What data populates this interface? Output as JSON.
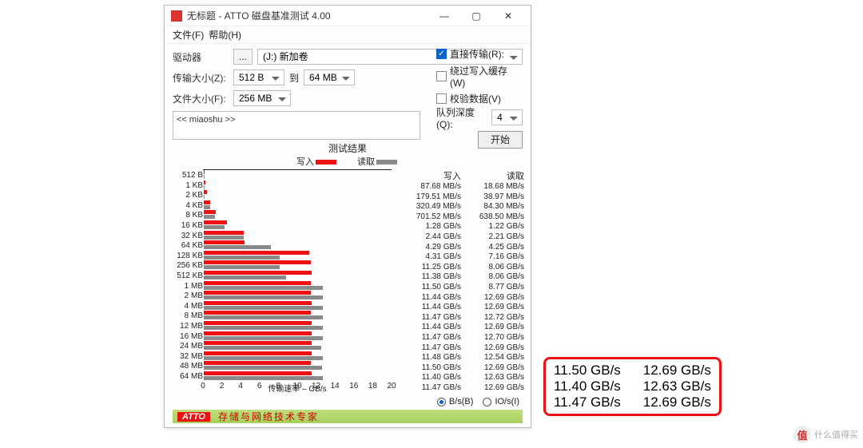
{
  "window": {
    "title": "无标题 - ATTO 磁盘基准测试 4.00",
    "menu": {
      "file": "文件(F)",
      "help": "帮助(H)"
    }
  },
  "form": {
    "drive_label": "驱动器",
    "browse": "...",
    "drive_value": "(J:) 新加卷",
    "xfersize_label": "传输大小(Z):",
    "xfersize_from": "512 B",
    "xfersize_to_label": "到",
    "xfersize_to": "64 MB",
    "filesize_label": "文件大小(F):",
    "filesize_value": "256 MB",
    "direct": "直接传输(R):",
    "direct_checked": true,
    "bypass": "绕过写入缓存(W)",
    "verify": "校验数据(V)",
    "qd_label": "队列深度(Q):",
    "qd_value": "4",
    "start": "开始",
    "desc": "<< miaoshu >>"
  },
  "results": {
    "title": "测试结果",
    "legend_write": "写入",
    "legend_read": "读取",
    "write_hdr": "写入",
    "read_hdr": "读取",
    "xaxis_label": "传输速率 – GB/s",
    "unit_bs": "B/s(B)",
    "unit_ios": "IO/s(I)"
  },
  "footer": {
    "logo": "ATTO",
    "slogan": "存储与网络技术专家"
  },
  "callout": {
    "rows": [
      {
        "w": "11.50 GB/s",
        "r": "12.69 GB/s"
      },
      {
        "w": "11.40 GB/s",
        "r": "12.63 GB/s"
      },
      {
        "w": "11.47 GB/s",
        "r": "12.69 GB/s"
      }
    ]
  },
  "watermark": "什么值得买",
  "chart_data": {
    "type": "bar",
    "orientation": "horizontal",
    "title": "测试结果",
    "xlabel": "传输速率 – GB/s",
    "xlim": [
      0,
      20
    ],
    "xticks": [
      0,
      2,
      4,
      6,
      8,
      10,
      12,
      14,
      16,
      18,
      20
    ],
    "categories": [
      "512 B",
      "1 KB",
      "2 KB",
      "4 KB",
      "8 KB",
      "16 KB",
      "32 KB",
      "64 KB",
      "128 KB",
      "256 KB",
      "512 KB",
      "1 MB",
      "2 MB",
      "4 MB",
      "8 MB",
      "12 MB",
      "16 MB",
      "24 MB",
      "32 MB",
      "48 MB",
      "64 MB"
    ],
    "series": [
      {
        "name": "写入",
        "unit": "GB/s",
        "display": [
          "87.68 MB/s",
          "179.51 MB/s",
          "320.49 MB/s",
          "701.52 MB/s",
          "1.28 GB/s",
          "2.44 GB/s",
          "4.29 GB/s",
          "4.31 GB/s",
          "11.25 GB/s",
          "11.38 GB/s",
          "11.50 GB/s",
          "11.44 GB/s",
          "11.44 GB/s",
          "11.47 GB/s",
          "11.44 GB/s",
          "11.47 GB/s",
          "11.47 GB/s",
          "11.48 GB/s",
          "11.50 GB/s",
          "11.40 GB/s",
          "11.47 GB/s"
        ],
        "values_gbps": [
          0.08768,
          0.17951,
          0.32049,
          0.70152,
          1.28,
          2.44,
          4.29,
          4.31,
          11.25,
          11.38,
          11.5,
          11.44,
          11.44,
          11.47,
          11.44,
          11.47,
          11.47,
          11.48,
          11.5,
          11.4,
          11.47
        ]
      },
      {
        "name": "读取",
        "unit": "GB/s",
        "display": [
          "18.68 MB/s",
          "38.97 MB/s",
          "84.30 MB/s",
          "638.50 MB/s",
          "1.22 GB/s",
          "2.21 GB/s",
          "4.25 GB/s",
          "7.16 GB/s",
          "8.06 GB/s",
          "8.06 GB/s",
          "8.77 GB/s",
          "12.69 GB/s",
          "12.69 GB/s",
          "12.72 GB/s",
          "12.69 GB/s",
          "12.70 GB/s",
          "12.69 GB/s",
          "12.54 GB/s",
          "12.69 GB/s",
          "12.63 GB/s",
          "12.69 GB/s"
        ],
        "values_gbps": [
          0.01868,
          0.03897,
          0.0843,
          0.6385,
          1.22,
          2.21,
          4.25,
          7.16,
          8.06,
          8.06,
          8.77,
          12.69,
          12.69,
          12.72,
          12.69,
          12.7,
          12.69,
          12.54,
          12.69,
          12.63,
          12.69
        ]
      }
    ]
  }
}
